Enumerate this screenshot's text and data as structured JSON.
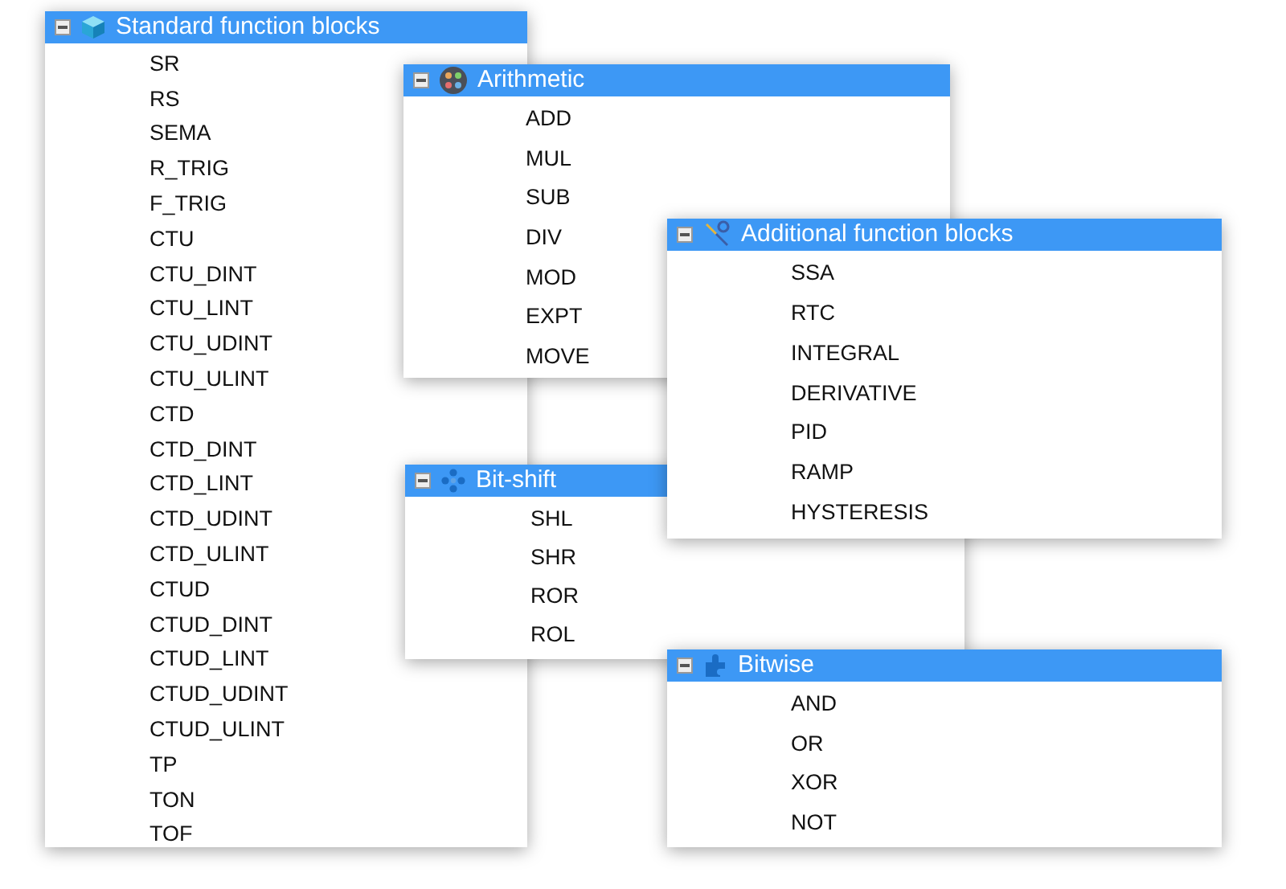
{
  "panels": [
    {
      "title": "Standard function blocks",
      "kind": "cube",
      "expanded": true,
      "items": [
        "SR",
        "RS",
        "SEMA",
        "R_TRIG",
        "F_TRIG",
        "CTU",
        "CTU_DINT",
        "CTU_LINT",
        "CTU_UDINT",
        "CTU_ULINT",
        "CTD",
        "CTD_DINT",
        "CTD_LINT",
        "CTD_UDINT",
        "CTD_ULINT",
        "CTUD",
        "CTUD_DINT",
        "CTUD_LINT",
        "CTUD_UDINT",
        "CTUD_ULINT",
        "TP",
        "TON",
        "TOF"
      ]
    },
    {
      "title": "Arithmetic",
      "kind": "palette",
      "expanded": true,
      "items": [
        "ADD",
        "MUL",
        "SUB",
        "DIV",
        "MOD",
        "EXPT",
        "MOVE"
      ]
    },
    {
      "title": "Additional function blocks",
      "kind": "tools",
      "expanded": true,
      "items": [
        "SSA",
        "RTC",
        "INTEGRAL",
        "DERIVATIVE",
        "PID",
        "RAMP",
        "HYSTERESIS"
      ]
    },
    {
      "title": "Bit-shift",
      "kind": "dots",
      "expanded": true,
      "items": [
        "SHL",
        "SHR",
        "ROR",
        "ROL"
      ]
    },
    {
      "title": "Bitwise",
      "kind": "puzzle",
      "expanded": true,
      "items": [
        "AND",
        "OR",
        "XOR",
        "NOT"
      ]
    }
  ]
}
